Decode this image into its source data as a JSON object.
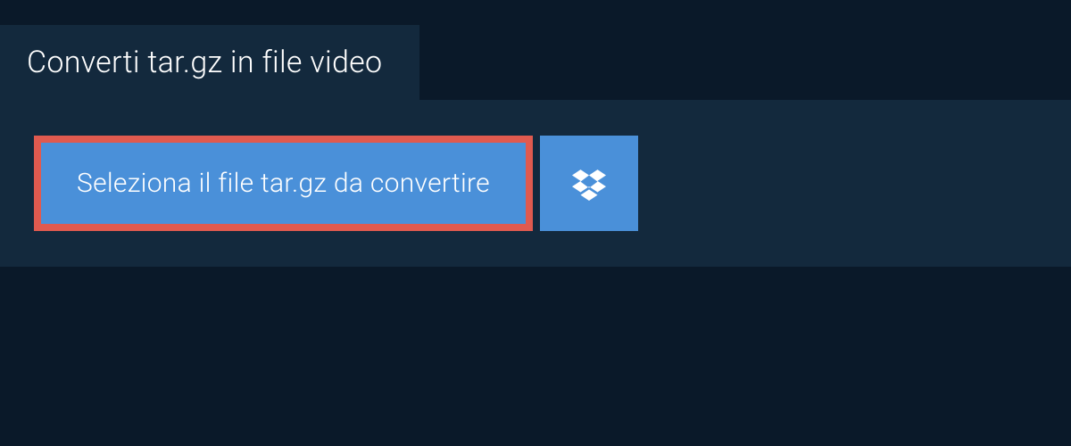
{
  "tab": {
    "label": "Converti tar.gz in file video"
  },
  "buttons": {
    "select_file_label": "Seleziona il file tar.gz da convertire"
  }
}
